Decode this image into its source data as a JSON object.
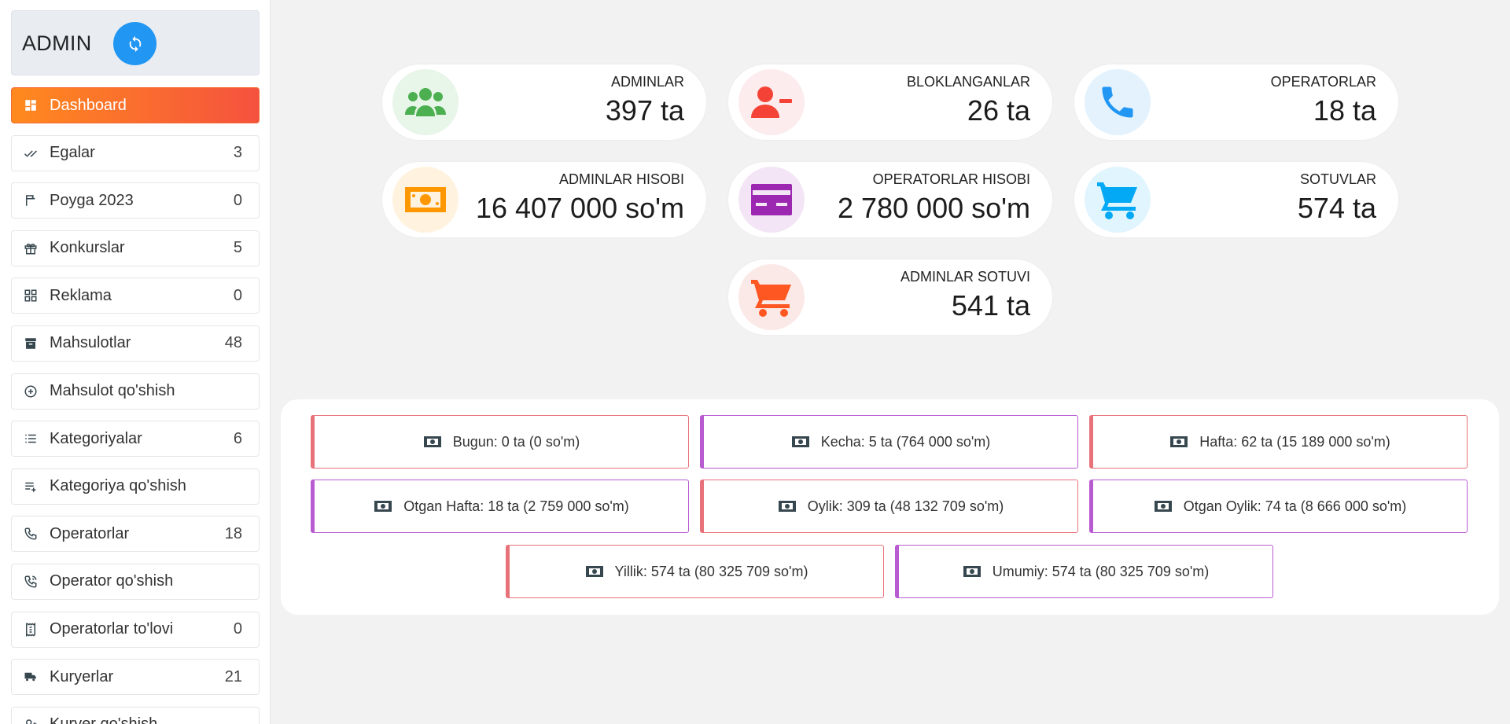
{
  "sidebar": {
    "title": "ADMIN",
    "refresh_icon": "refresh-icon",
    "items": [
      {
        "label": "Dashboard",
        "count": "",
        "icon": "dashboard-icon"
      },
      {
        "label": "Egalar",
        "count": "3",
        "icon": "double-check-icon"
      },
      {
        "label": "Poyga 2023",
        "count": "0",
        "icon": "flag-icon"
      },
      {
        "label": "Konkurslar",
        "count": "5",
        "icon": "gift-icon"
      },
      {
        "label": "Reklama",
        "count": "0",
        "icon": "grid-icon"
      },
      {
        "label": "Mahsulotlar",
        "count": "48",
        "icon": "archive-icon"
      },
      {
        "label": "Mahsulot qo'shish",
        "count": "",
        "icon": "plus-circle-icon"
      },
      {
        "label": "Kategoriyalar",
        "count": "6",
        "icon": "list-icon"
      },
      {
        "label": "Kategoriya qo'shish",
        "count": "",
        "icon": "playlist-add-icon"
      },
      {
        "label": "Operatorlar",
        "count": "18",
        "icon": "phone-icon"
      },
      {
        "label": "Operator qo'shish",
        "count": "",
        "icon": "phone-add-icon"
      },
      {
        "label": "Operatorlar to'lovi",
        "count": "0",
        "icon": "receipt-icon"
      },
      {
        "label": "Kuryerlar",
        "count": "21",
        "icon": "truck-icon"
      },
      {
        "label": "Kuryer qo'shish",
        "count": "",
        "icon": "user-add-icon"
      }
    ]
  },
  "stats": [
    {
      "label": "ADMINLAR",
      "value": "397 ta",
      "icon": "users-icon",
      "color": "#4caf50",
      "bg": "#e8f5e9"
    },
    {
      "label": "BLOKLANGANLAR",
      "value": "26 ta",
      "icon": "user-minus-icon",
      "color": "#f44336",
      "bg": "#fdecee"
    },
    {
      "label": "OPERATORLAR",
      "value": "18 ta",
      "icon": "phone-icon",
      "color": "#2196f3",
      "bg": "#e3f2fd"
    },
    {
      "label": "ADMINLAR HISOBI",
      "value": "16 407 000 so'm",
      "icon": "money-icon",
      "color": "#ff9800",
      "bg": "#fff3e0"
    },
    {
      "label": "OPERATORLAR HISOBI",
      "value": "2 780 000 so'm",
      "icon": "credit-card-icon",
      "color": "#9c27b0",
      "bg": "#f3e5f5"
    },
    {
      "label": "SOTUVLAR",
      "value": "574 ta",
      "icon": "cart-icon",
      "color": "#03a9f4",
      "bg": "#e1f5fe"
    },
    {
      "label": "ADMINLAR SOTUVI",
      "value": "541 ta",
      "icon": "cart-icon",
      "color": "#ff5722",
      "bg": "#fbe9e7"
    }
  ],
  "summary": [
    {
      "text": "Bugun: 0 ta (0 so'm)",
      "accent": "red"
    },
    {
      "text": "Kecha: 5 ta (764 000 so'm)",
      "accent": "purple"
    },
    {
      "text": "Hafta: 62 ta (15 189 000 so'm)",
      "accent": "red"
    },
    {
      "text": "Otgan Hafta: 18 ta (2 759 000 so'm)",
      "accent": "purple"
    },
    {
      "text": "Oylik: 309 ta (48 132 709 so'm)",
      "accent": "red"
    },
    {
      "text": "Otgan Oylik: 74 ta (8 666 000 so'm)",
      "accent": "purple"
    },
    {
      "text": "Yillik: 574 ta (80 325 709 so'm)",
      "accent": "red"
    },
    {
      "text": "Umumiy: 574 ta (80 325 709 so'm)",
      "accent": "purple"
    }
  ],
  "colors": {
    "accent_orange": "#ff8a1e",
    "accent_red": "#f5523e",
    "refresh_blue": "#2196f3",
    "border_red": "#e8727a",
    "border_purple": "#b85bd0"
  }
}
